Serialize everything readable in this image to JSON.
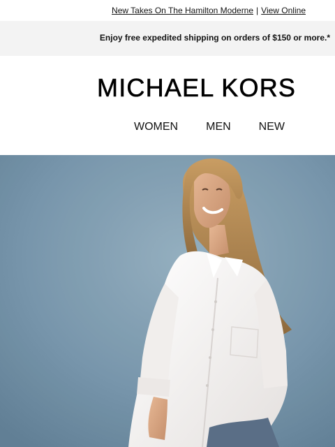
{
  "preheader": {
    "promo_link": "New Takes On The Hamilton Moderne",
    "separator": "|",
    "view_online": "View Online"
  },
  "shipping_banner": {
    "text": "Enjoy free expedited shipping on orders of $150 or more.*"
  },
  "brand": {
    "logo": "MICHAEL KORS"
  },
  "nav": {
    "items": [
      "WOMEN",
      "MEN",
      "NEW"
    ]
  },
  "hero": {
    "image": "model-photo",
    "colors": {
      "backdrop": "#6f8fa6",
      "shirt": "#f6f4f2",
      "hair": "#b58a52",
      "skin": "#d9a986",
      "denim": "#5a6e86"
    }
  }
}
